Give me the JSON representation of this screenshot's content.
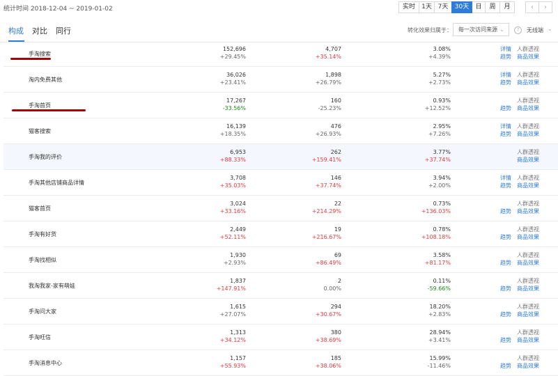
{
  "header": {
    "stat_time": "统计时间 2018-12-04 ~ 2019-01-02",
    "period_buttons": [
      {
        "label": "实时",
        "active": false
      },
      {
        "label": "1天",
        "active": false
      },
      {
        "label": "7天",
        "active": false
      },
      {
        "label": "30天",
        "active": true
      },
      {
        "label": "日",
        "active": false
      },
      {
        "label": "周",
        "active": false
      },
      {
        "label": "月",
        "active": false
      }
    ],
    "prev_icon": "‹",
    "next_icon": "›"
  },
  "tabs": [
    {
      "label": "构成",
      "active": true
    },
    {
      "label": "对比",
      "active": false
    },
    {
      "label": "同行",
      "active": false
    }
  ],
  "filters": {
    "attribution_label": "转化效果归属于：",
    "attribution_value": "每一次访问来源",
    "help_icon": "?",
    "terminal_value": "无线端"
  },
  "colors": {
    "accent": "#2f7bd8",
    "increase": "#e4393c",
    "decrease": "#1b8a1b",
    "annotation_underline": "#a00000"
  },
  "rows": [
    {
      "name": "手淘搜索",
      "visitors": "152,696",
      "visitors_change": "+29.45%",
      "visitors_dir": "grey",
      "buyers": "4,707",
      "buyers_change": "+35.14%",
      "buyers_dir": "red",
      "rate": "3.08%",
      "rate_change": "+4.39%",
      "rate_dir": "grey",
      "link_detail": "详情",
      "link_trend": "趋势",
      "link_crowd": "人群透视",
      "link_goods": "商品效果",
      "show_detail": true,
      "underlined": true
    },
    {
      "name": "淘内免费其他",
      "visitors": "36,026",
      "visitors_change": "+23.41%",
      "visitors_dir": "grey",
      "buyers": "1,898",
      "buyers_change": "+26.79%",
      "buyers_dir": "grey",
      "rate": "5.27%",
      "rate_change": "+2.73%",
      "rate_dir": "grey",
      "link_detail": "详情",
      "link_trend": "趋势",
      "link_crowd": "人群透视",
      "link_goods": "商品效果",
      "show_detail": true,
      "underlined": false
    },
    {
      "name": "手淘首页",
      "visitors": "17,267",
      "visitors_change": "-33.56%",
      "visitors_dir": "green",
      "buyers": "160",
      "buyers_change": "-25.23%",
      "buyers_dir": "grey",
      "rate": "0.93%",
      "rate_change": "+12.52%",
      "rate_dir": "grey",
      "link_detail": "",
      "link_trend": "趋势",
      "link_crowd": "人群透视",
      "link_goods": "商品效果",
      "show_detail": false,
      "underlined": true
    },
    {
      "name": "猫客搜索",
      "visitors": "16,139",
      "visitors_change": "+18.35%",
      "visitors_dir": "grey",
      "buyers": "476",
      "buyers_change": "+26.93%",
      "buyers_dir": "grey",
      "rate": "2.95%",
      "rate_change": "+7.26%",
      "rate_dir": "grey",
      "link_detail": "详情",
      "link_trend": "趋势",
      "link_crowd": "人群透视",
      "link_goods": "商品效果",
      "show_detail": true,
      "underlined": false
    },
    {
      "name": "手淘我的评价",
      "visitors": "6,953",
      "visitors_change": "+88.33%",
      "visitors_dir": "red",
      "buyers": "262",
      "buyers_change": "+159.41%",
      "buyers_dir": "red",
      "rate": "3.77%",
      "rate_change": "+37.74%",
      "rate_dir": "red",
      "link_detail": "",
      "link_trend": "",
      "link_crowd": "人群透视",
      "link_goods": "商品效果",
      "show_detail": false,
      "underlined": false,
      "highlighted": true
    },
    {
      "name": "手淘其他店铺商品详情",
      "visitors": "3,708",
      "visitors_change": "+35.03%",
      "visitors_dir": "red",
      "buyers": "146",
      "buyers_change": "+37.74%",
      "buyers_dir": "red",
      "rate": "3.94%",
      "rate_change": "+2.00%",
      "rate_dir": "grey",
      "link_detail": "详情",
      "link_trend": "趋势",
      "link_crowd": "人群透视",
      "link_goods": "商品效果",
      "show_detail": true,
      "underlined": false
    },
    {
      "name": "猫客首页",
      "visitors": "3,024",
      "visitors_change": "+33.16%",
      "visitors_dir": "red",
      "buyers": "22",
      "buyers_change": "+214.29%",
      "buyers_dir": "red",
      "rate": "0.73%",
      "rate_change": "+136.03%",
      "rate_dir": "red",
      "link_detail": "",
      "link_trend": "趋势",
      "link_crowd": "人群透视",
      "link_goods": "商品效果",
      "show_detail": false,
      "underlined": false
    },
    {
      "name": "手淘有好货",
      "visitors": "2,449",
      "visitors_change": "+52.11%",
      "visitors_dir": "red",
      "buyers": "19",
      "buyers_change": "+216.67%",
      "buyers_dir": "red",
      "rate": "0.78%",
      "rate_change": "+108.18%",
      "rate_dir": "red",
      "link_detail": "",
      "link_trend": "趋势",
      "link_crowd": "人群透视",
      "link_goods": "商品效果",
      "show_detail": false,
      "underlined": false
    },
    {
      "name": "手淘找相似",
      "visitors": "1,930",
      "visitors_change": "+2.93%",
      "visitors_dir": "grey",
      "buyers": "69",
      "buyers_change": "+86.49%",
      "buyers_dir": "red",
      "rate": "3.58%",
      "rate_change": "+81.17%",
      "rate_dir": "red",
      "link_detail": "",
      "link_trend": "趋势",
      "link_crowd": "人群透视",
      "link_goods": "商品效果",
      "show_detail": false,
      "underlined": false
    },
    {
      "name": "我淘我家-家有萌娃",
      "visitors": "1,837",
      "visitors_change": "+147.91%",
      "visitors_dir": "red",
      "buyers": "2",
      "buyers_change": "0.00%",
      "buyers_dir": "grey",
      "rate": "0.11%",
      "rate_change": "-59.66%",
      "rate_dir": "green",
      "link_detail": "",
      "link_trend": "趋势",
      "link_crowd": "人群透视",
      "link_goods": "商品效果",
      "show_detail": false,
      "underlined": false
    },
    {
      "name": "手淘问大家",
      "visitors": "1,615",
      "visitors_change": "+27.07%",
      "visitors_dir": "grey",
      "buyers": "294",
      "buyers_change": "+30.67%",
      "buyers_dir": "red",
      "rate": "18.20%",
      "rate_change": "+2.83%",
      "rate_dir": "grey",
      "link_detail": "",
      "link_trend": "趋势",
      "link_crowd": "人群透视",
      "link_goods": "商品效果",
      "show_detail": false,
      "underlined": false
    },
    {
      "name": "手淘旺信",
      "visitors": "1,313",
      "visitors_change": "+34.12%",
      "visitors_dir": "red",
      "buyers": "380",
      "buyers_change": "+38.69%",
      "buyers_dir": "red",
      "rate": "28.94%",
      "rate_change": "+3.41%",
      "rate_dir": "grey",
      "link_detail": "",
      "link_trend": "趋势",
      "link_crowd": "人群透视",
      "link_goods": "商品效果",
      "show_detail": false,
      "underlined": false
    },
    {
      "name": "手淘消息中心",
      "visitors": "1,157",
      "visitors_change": "+55.93%",
      "visitors_dir": "red",
      "buyers": "185",
      "buyers_change": "+38.06%",
      "buyers_dir": "red",
      "rate": "15.99%",
      "rate_change": "-11.46%",
      "rate_dir": "grey",
      "link_detail": "",
      "link_trend": "趋势",
      "link_crowd": "人群透视",
      "link_goods": "商品效果",
      "show_detail": false,
      "underlined": false
    }
  ]
}
